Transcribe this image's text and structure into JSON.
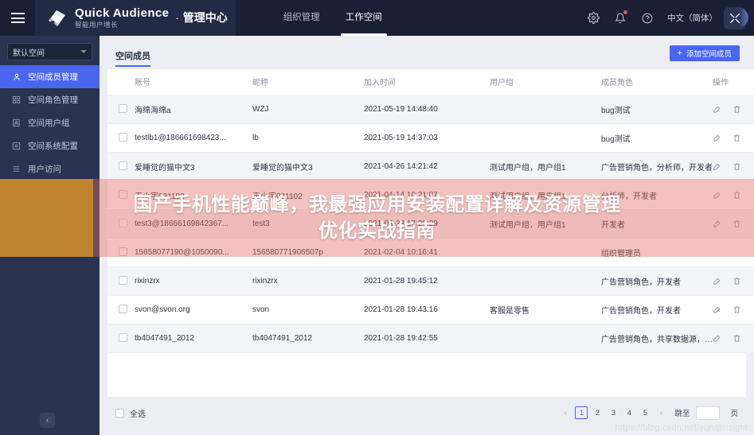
{
  "header": {
    "menu_icon": "hamburger-icon",
    "brand_name": "Quick Audience",
    "brand_sub": "智能用户增长",
    "separator": "·",
    "console_title": "管理中心",
    "nav": [
      {
        "label": "组织管理",
        "active": false
      },
      {
        "label": "工作空间",
        "active": true
      }
    ],
    "icons": [
      {
        "name": "gear-icon"
      },
      {
        "name": "bell-icon"
      },
      {
        "name": "help-icon"
      }
    ],
    "language": "中文（简体）",
    "avatar": "expand-icon"
  },
  "sidebar": {
    "space_selector": {
      "value": "默认空间",
      "caret": "chevron-down-icon"
    },
    "items": [
      {
        "label": "空间成员管理",
        "icon": "user-icon",
        "active": true
      },
      {
        "label": "空间角色管理",
        "icon": "grid-icon",
        "active": false
      },
      {
        "label": "空间用户组",
        "icon": "contacts-icon",
        "active": false
      },
      {
        "label": "空间系统配置",
        "icon": "settings-icon",
        "active": false
      },
      {
        "label": "用户访问",
        "icon": "list-icon",
        "active": false
      }
    ],
    "collapse_label": "‹"
  },
  "panel": {
    "tab_label": "空间成员",
    "add_button": {
      "plus": "+",
      "label": "添加空间成员"
    },
    "columns": [
      "账号",
      "昵称",
      "加入时间",
      "用户组",
      "成员角色",
      "操作"
    ],
    "rows": [
      {
        "account": "海绵海绵a",
        "nickname": "WZJ",
        "join_time": "2021-05-19 14:48:40",
        "user_group": "",
        "role": "bug测试",
        "has_ops": true
      },
      {
        "account": "testlb1@186661698423...",
        "nickname": "lb",
        "join_time": "2021-05-19 14:37:03",
        "user_group": "",
        "role": "bug测试",
        "has_ops": true
      },
      {
        "account": "爱睡觉的猫中文3",
        "nickname": "爱睡觉的猫中文3",
        "join_time": "2021-04-26 14:21:42",
        "user_group": "测试用户组，用户组1",
        "role": "广告营销角色，分析师，开发者",
        "has_ops": true
      },
      {
        "account": "王小宇031102",
        "nickname": "王小宇031102",
        "join_time": "2021-04-14 10:21:07",
        "user_group": "测试用户组，用户组1",
        "role": "分析师，开发者",
        "has_ops": true
      },
      {
        "account": "test3@18666169842367...",
        "nickname": "test3",
        "join_time": "2021-03-23 17:20:29",
        "user_group": "测试用户组，用户组1",
        "role": "开发者",
        "has_ops": true
      },
      {
        "account": "15658077190@1050090...",
        "nickname": "156580771906507p",
        "join_time": "2021-02-04 10:16:41",
        "user_group": "",
        "role": "组织管理员",
        "has_ops": false
      },
      {
        "account": "rixinzrx",
        "nickname": "rixinzrx",
        "join_time": "2021-01-28 19:45:12",
        "user_group": "",
        "role": "广告营销角色，开发者",
        "has_ops": true
      },
      {
        "account": "svon@svon.org",
        "nickname": "svon",
        "join_time": "2021-01-28 19:43:16",
        "user_group": "客服是零售",
        "role": "广告营销角色，开发者",
        "has_ops": true
      },
      {
        "account": "tb4047491_2012",
        "nickname": "tb4047491_2012",
        "join_time": "2021-01-28 19:42:55",
        "user_group": "",
        "role": "广告营销角色，共享数据源，开发者",
        "has_ops": true
      }
    ],
    "footer": {
      "select_all_label": "全选",
      "prev": "‹",
      "pages": [
        "1",
        "2",
        "3",
        "4",
        "5"
      ],
      "current_page": "1",
      "next": "›",
      "jump_label": "跳至",
      "jump_value": "",
      "page_unit": "页"
    }
  },
  "overlay": {
    "line1": "国产手机性能巅峰，我最强应用安装配置详解及资源管理",
    "line2": "优化实战指南"
  },
  "watermark": "https://blog.csdn.net/yunqiinsight",
  "colors": {
    "header_bg": "#191f35",
    "sidebar_bg": "#2b3350",
    "accent": "#4a66f0",
    "page_bg": "#eceef3",
    "overlay_left": "#c1842f",
    "overlay_right": "#e26e64"
  }
}
